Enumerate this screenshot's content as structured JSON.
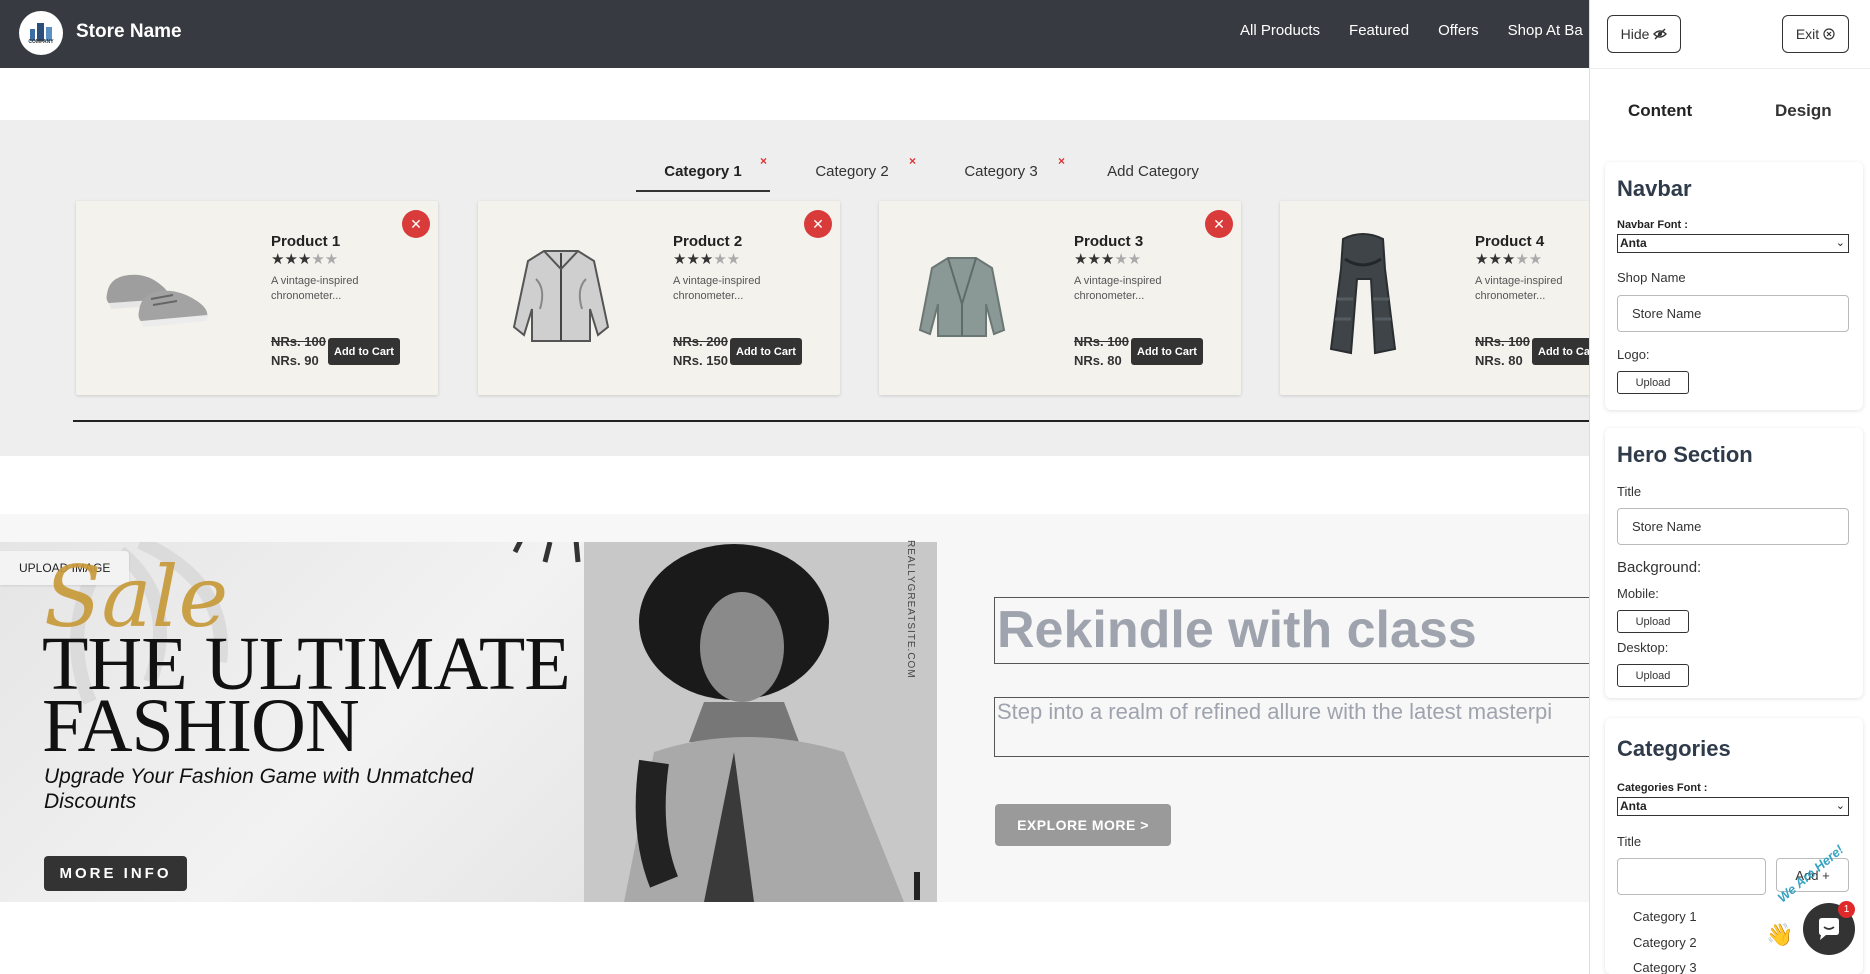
{
  "navbar": {
    "logo_text": "COMPANY",
    "store_name": "Store Name",
    "links": [
      "All Products",
      "Featured",
      "Offers",
      "Shop At Ba"
    ]
  },
  "categories": {
    "tabs": [
      "Category 1",
      "Category 2",
      "Category 3",
      "Add Category"
    ],
    "close_glyph": "×",
    "products": [
      {
        "name": "Product 1",
        "rating": 3,
        "desc": "A vintage-inspired chronometer...",
        "old_price": "NRs. 100",
        "new_price": "NRs. 90",
        "cart": "Add to Cart",
        "image": "shoes"
      },
      {
        "name": "Product 2",
        "rating": 3,
        "desc": "A vintage-inspired chronometer...",
        "old_price": "NRs. 200",
        "new_price": "NRs. 150",
        "cart": "Add to Cart",
        "image": "jacket"
      },
      {
        "name": "Product 3",
        "rating": 3,
        "desc": "A vintage-inspired chronometer...",
        "old_price": "NRs. 100",
        "new_price": "NRs. 80",
        "cart": "Add to Cart",
        "image": "cardigan"
      },
      {
        "name": "Product 4",
        "rating": 3,
        "desc": "A vintage-inspired chronometer...",
        "old_price": "NRs. 100",
        "new_price": "NRs. 80",
        "cart": "Add to Ca",
        "image": "scarf"
      }
    ]
  },
  "banner": {
    "upload_label": "UPLOAD IMAGE",
    "script": "Sale",
    "line1": "THE ULTIMATE",
    "line2": "FASHION",
    "subtitle": "Upgrade Your Fashion Game with Unmatched Discounts",
    "more_info": "MORE INFO",
    "vertical": "REALLYGREATSITE.COM"
  },
  "hero": {
    "title": "Rekindle with class",
    "description": "Step into a realm of refined allure with the latest masterpi",
    "explore": "EXPLORE MORE  >"
  },
  "panel": {
    "hide_label": "Hide",
    "exit_label": "Exit",
    "tabs": [
      "Content",
      "Design"
    ],
    "navbar_section": {
      "title": "Navbar",
      "font_label": "Navbar Font :",
      "font_value": "Anta",
      "shop_name_label": "Shop Name",
      "shop_name_value": "Store Name",
      "logo_label": "Logo:",
      "upload": "Upload"
    },
    "hero_section": {
      "title": "Hero Section",
      "title_label": "Title",
      "title_value": "Store Name",
      "background_label": "Background:",
      "mobile_label": "Mobile:",
      "desktop_label": "Desktop:",
      "upload": "Upload"
    },
    "categories_section": {
      "title": "Categories",
      "font_label": "Categories Font :",
      "font_value": "Anta",
      "title_label": "Title",
      "add_label": "Add +",
      "items": [
        "Category 1",
        "Category 2",
        "Category 3"
      ]
    }
  },
  "chat": {
    "badge": "1",
    "tag": "We Are Here!",
    "wave": "👋"
  },
  "colors": {
    "navbar": "#373a40",
    "accent": "#d93a3a",
    "dark_button": "#333333",
    "hero_placeholder": "#9ea3ad"
  }
}
